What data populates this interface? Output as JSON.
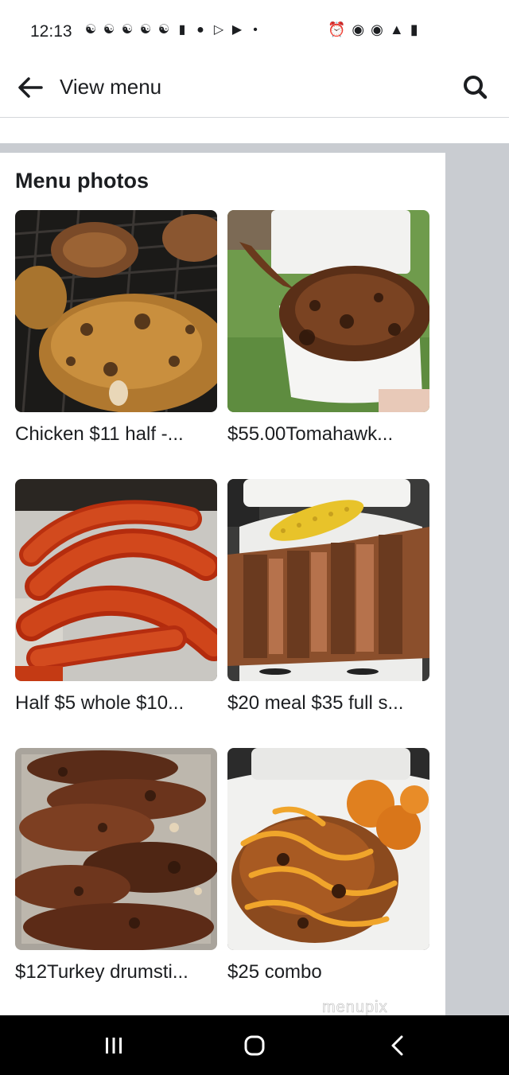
{
  "status_bar": {
    "time": "12:13",
    "notification_icons": [
      "notif-icon",
      "notif-icon",
      "notif-icon",
      "notif-icon",
      "notif-icon",
      "chat-icon",
      "messenger-icon",
      "play-icon",
      "youtube-icon",
      "dot-icon"
    ],
    "system_icons": [
      "alarm-icon",
      "location-icon",
      "wifi-icon",
      "signal-icon",
      "battery-icon"
    ]
  },
  "header": {
    "title": "View menu",
    "back_icon": "back-arrow-icon",
    "search_icon": "search-icon"
  },
  "section": {
    "title": "Menu photos"
  },
  "photos": [
    {
      "caption": "Chicken $11 half -...",
      "subject": "grilled chicken"
    },
    {
      "caption": "$55.00Tomahawk...",
      "subject": "tomahawk steak"
    },
    {
      "caption": "Half $5 whole $10...",
      "subject": "smoked sausages"
    },
    {
      "caption": "$20 meal $35 full s...",
      "subject": "ribs with corn"
    },
    {
      "caption": "$12Turkey drumsti...",
      "subject": "turkey drumsticks"
    },
    {
      "caption": "$25 combo",
      "subject": "combo with sauce"
    }
  ],
  "watermark": "menupix",
  "nav_bar": {
    "icons": [
      "recents-icon",
      "home-icon",
      "back-icon"
    ]
  },
  "colors": {
    "panel_bg": "#ffffff",
    "side_gray": "#c9ccd1",
    "text": "#1c1e21",
    "nav_bg": "#000000"
  }
}
